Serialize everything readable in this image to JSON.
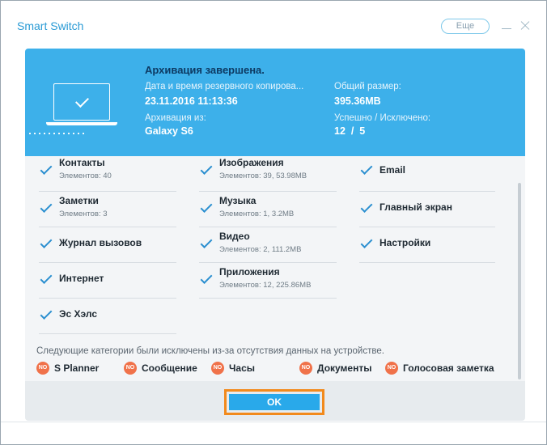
{
  "window": {
    "title": "Smart Switch",
    "more_label": "Еще",
    "minimize_icon": "minimize-icon",
    "close_icon": "close-icon"
  },
  "banner": {
    "title": "Архивация завершена.",
    "icon": "laptop-check-icon",
    "date_label": "Дата и время резервного копирова...",
    "date_value": "23.11.2016 11:13:36",
    "size_label": "Общий размер:",
    "size_value": "395.36MB",
    "source_label": "Архивация из:",
    "source_value": "Galaxy S6",
    "result_label": "Успешно / Исключено:",
    "result_value": "12  /  5"
  },
  "categories": [
    {
      "name": "Контакты",
      "sub": "Элементов: 40"
    },
    {
      "name": "Изображения",
      "sub": "Элементов: 39, 53.98MB"
    },
    {
      "name": "Email",
      "sub": ""
    },
    {
      "name": "Заметки",
      "sub": "Элементов: 3"
    },
    {
      "name": "Музыка",
      "sub": "Элементов: 1, 3.2MB"
    },
    {
      "name": "Главный экран",
      "sub": ""
    },
    {
      "name": "Журнал вызовов",
      "sub": ""
    },
    {
      "name": "Видео",
      "sub": "Элементов: 2, 111.2MB"
    },
    {
      "name": "Настройки",
      "sub": ""
    },
    {
      "name": "Интернет",
      "sub": ""
    },
    {
      "name": "Приложения",
      "sub": "Элементов: 12, 225.86MB"
    },
    {
      "name": "Эс Хэлс",
      "sub": ""
    }
  ],
  "excluded": {
    "note": "Следующие категории были исключены из-за отсутствия данных на устройстве.",
    "badge": "NO",
    "items": [
      "S Planner",
      "Сообщение",
      "Часы",
      "Документы",
      "Голосовая заметка"
    ]
  },
  "footer": {
    "ok_label": "OK"
  },
  "colors": {
    "banner": "#3db0ea",
    "accent": "#2a9bd5",
    "ok_button": "#29a9ea",
    "highlight": "#f28a1c",
    "excluded_badge": "#f0724a"
  }
}
